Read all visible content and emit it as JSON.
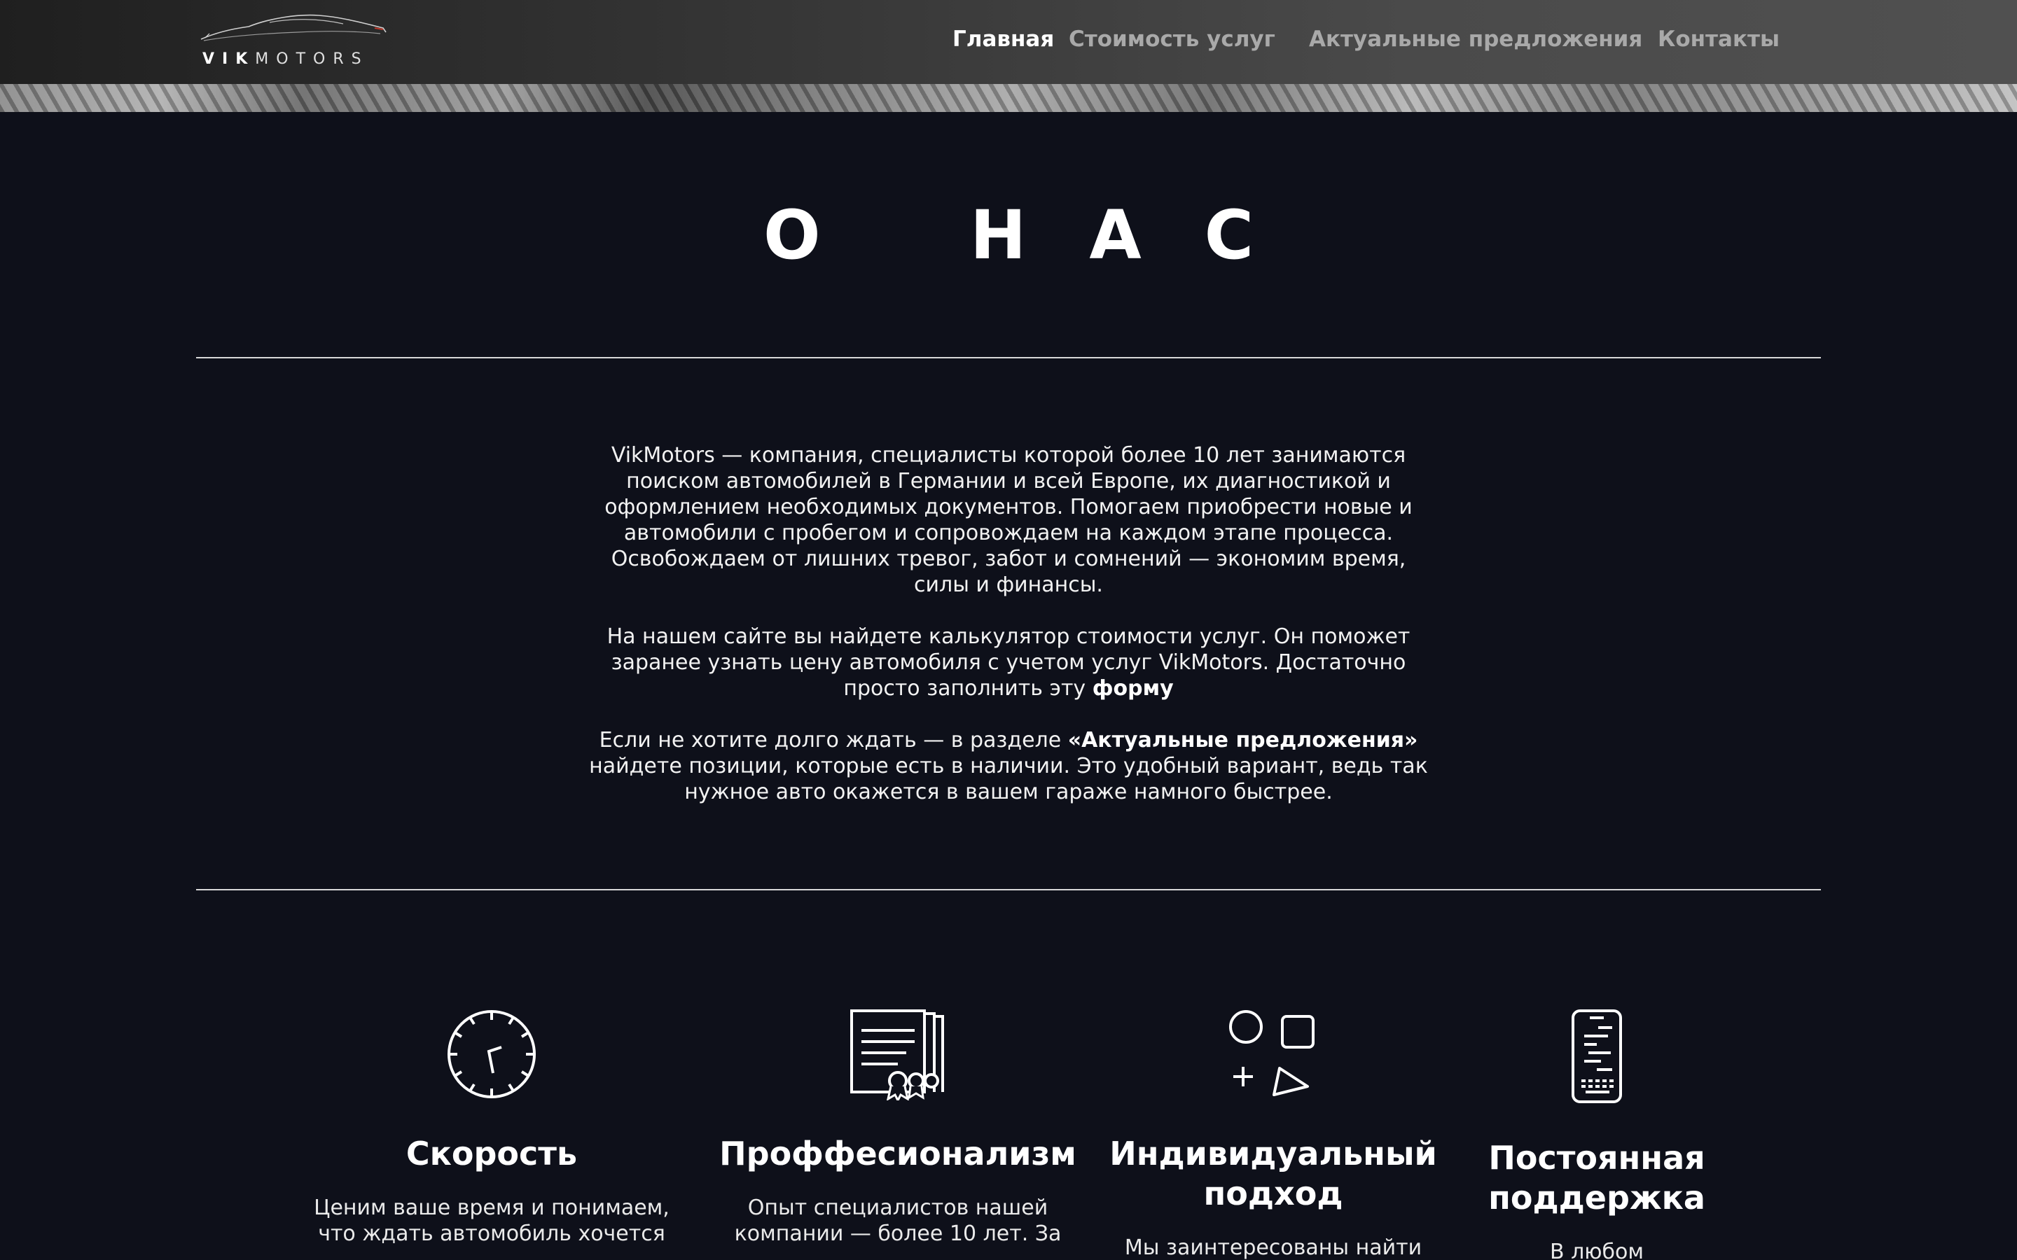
{
  "header": {
    "logo_text_bold": "VIK",
    "logo_text_light": "MOTORS",
    "nav": [
      {
        "label": "Главная",
        "active": true
      },
      {
        "label": "Стоимость услуг",
        "active": false
      },
      {
        "label": "Актуальные предложения",
        "active": false
      },
      {
        "label": "Контакты",
        "active": false
      }
    ]
  },
  "about": {
    "title": "О НАС",
    "paragraph1": "VikMotors — компания, специалисты которой более 10 лет занимаются поиском автомобилей в Германии и всей Европе, их диагностикой и оформлением необходимых документов. Помогаем приобрести новые и автомобили с пробегом и сопровождаем на каждом этапе процесса. Освобождаем от лишних тревог, забот и сомнений — экономим время, силы и финансы.",
    "paragraph2_text": "На нашем сайте вы найдете калькулятор стоимости услуг. Он поможет заранее узнать цену автомобиля с учетом услуг VikMotors. Достаточно просто заполнить эту ",
    "paragraph2_link": "форму",
    "paragraph3_before": "Если не хотите долго ждать — в разделе ",
    "paragraph3_link": "«Актуальные предложения»",
    "paragraph3_after": " найдете позиции, которые есть в наличии. Это удобный вариант, ведь так нужное авто окажется в вашем гараже намного быстрее."
  },
  "features": [
    {
      "icon": "clock-icon",
      "title": "Скорость",
      "text": "Ценим ваше время и понимаем, что ждать автомобиль хочется"
    },
    {
      "icon": "certificate-icon",
      "title": "Проффесионализм",
      "text": "Опыт специалистов нашей компании — более 10 лет. За"
    },
    {
      "icon": "shapes-icon",
      "title": "Индивидуальный подход",
      "text": "Мы заинтересованы найти"
    },
    {
      "icon": "phone-icon",
      "title": "Постоянная поддержка",
      "text": "В любом"
    }
  ],
  "colors": {
    "background": "#0e101a",
    "text": "#ffffff",
    "nav_inactive": "#a9a9a9"
  }
}
